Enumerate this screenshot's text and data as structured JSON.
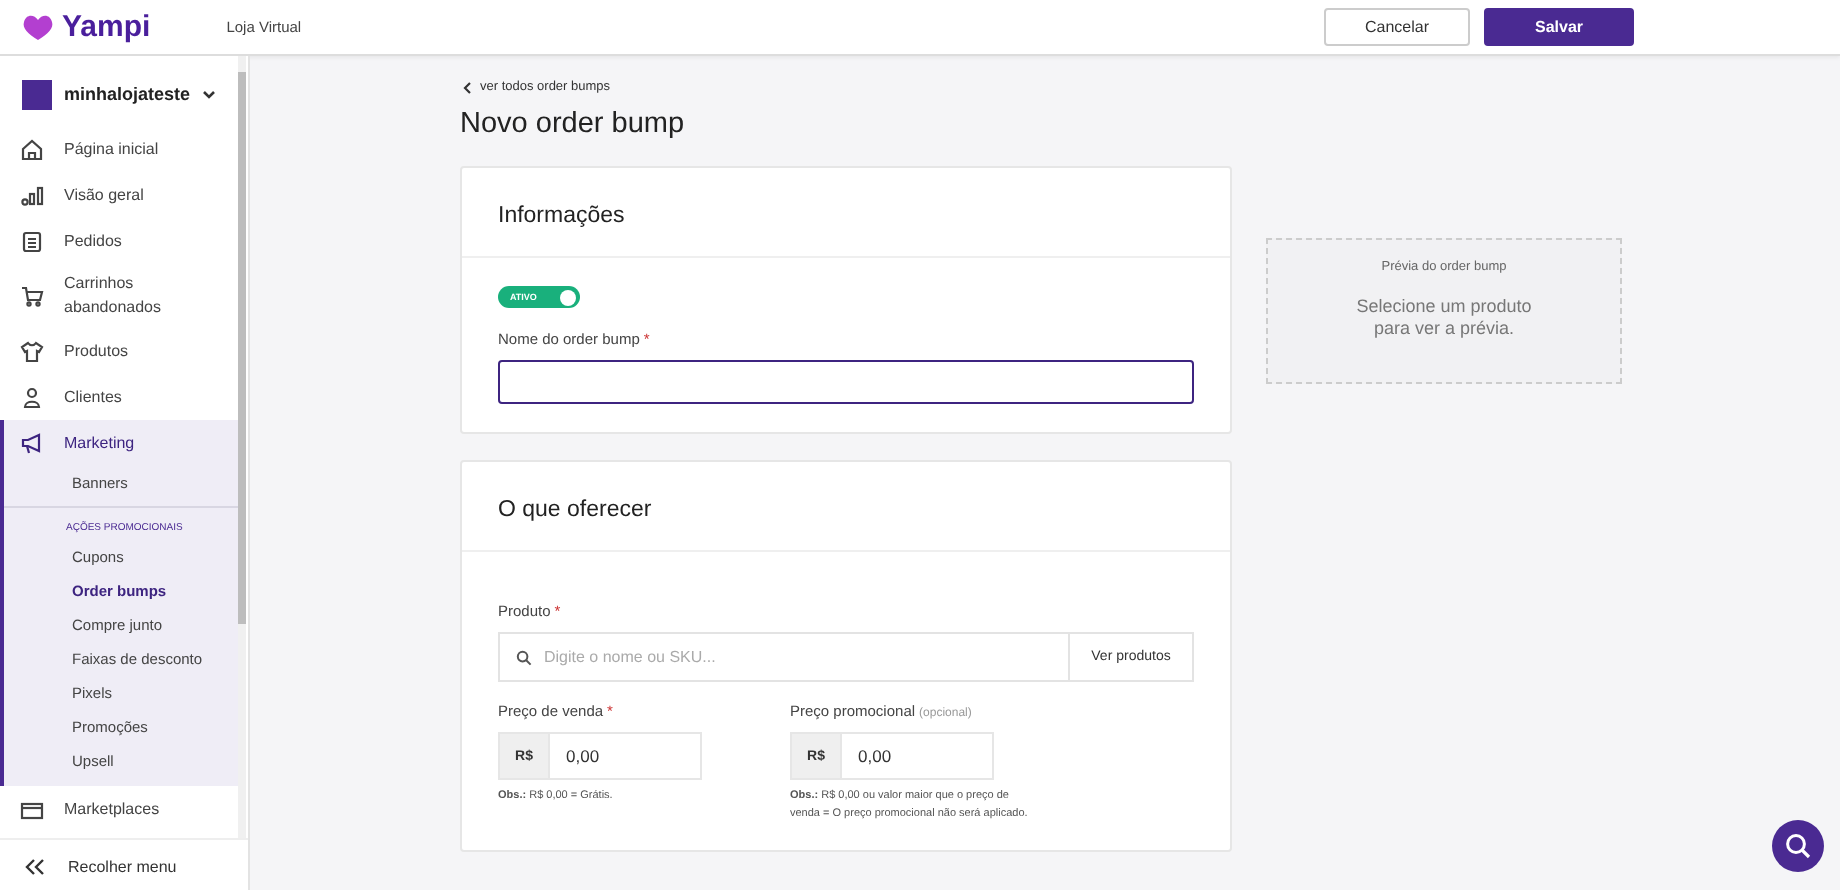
{
  "header": {
    "logo": "Yampi",
    "subtitle": "Loja Virtual",
    "buttons": [
      {
        "label": "Cancelar",
        "kind": "secondary"
      },
      {
        "label": "Salvar",
        "kind": "primary"
      }
    ]
  },
  "sidebar": {
    "store": {
      "name": "minhalojateste"
    },
    "items": [
      {
        "label": "Página inicial",
        "selected": false
      },
      {
        "label": "Visão geral",
        "selected": false
      },
      {
        "label": "Pedidos",
        "selected": false
      },
      {
        "label": "Carrinhos abandonados",
        "selected": false
      },
      {
        "label": "Produtos",
        "selected": false
      },
      {
        "label": "Clientes",
        "selected": false
      },
      {
        "label": "Marketing",
        "selected": true,
        "expanded": true,
        "children": [
          {
            "label": "Banners",
            "selected": false
          }
        ],
        "section": {
          "title": "AÇÕES PROMOCIONAIS",
          "items": [
            {
              "label": "Cupons",
              "selected": false
            },
            {
              "label": "Order bumps",
              "selected": true
            },
            {
              "label": "Compre junto",
              "selected": false
            },
            {
              "label": "Faixas de desconto",
              "selected": false
            },
            {
              "label": "Pixels",
              "selected": false
            },
            {
              "label": "Promoções",
              "selected": false
            },
            {
              "label": "Upsell",
              "selected": false
            }
          ]
        }
      },
      {
        "label": "Marketplaces",
        "selected": false
      }
    ],
    "collapse": "Recolher menu"
  },
  "page": {
    "back_link": "ver todos order bumps",
    "title": "Novo order bump"
  },
  "info_card": {
    "title": "Informações",
    "toggle": {
      "label": "ATIVO",
      "on": true
    },
    "name_field": {
      "label": "Nome do order bump",
      "required_mark": "*",
      "focused": true
    }
  },
  "offer_card": {
    "title": "O que oferecer",
    "product": {
      "label": "Produto",
      "required_mark": "*",
      "placeholder": "Digite o nome ou SKU...",
      "button": "Ver produtos"
    },
    "prices": [
      {
        "label": "Preço de venda",
        "required_mark": "*",
        "currency": "R$",
        "value": "0,00",
        "note": "**Obs.:** R$ 0,00 = Grátis."
      },
      {
        "label": "Preço promocional",
        "hint": "(opcional)",
        "currency": "R$",
        "value": "0,00",
        "note": "**Obs.:** R$ 0,00 ou valor maior que o preço de venda = O preço promocional não será aplicado."
      }
    ]
  },
  "preview": {
    "title": "Prévia do order bump",
    "message": "Selecione um produto para ver a prévia."
  }
}
